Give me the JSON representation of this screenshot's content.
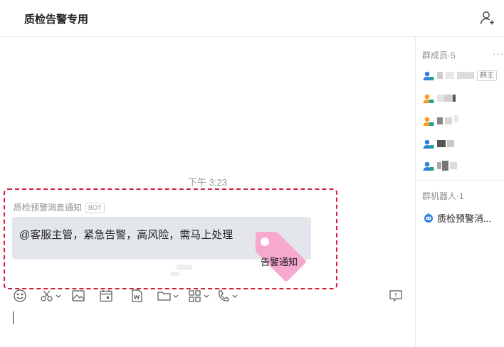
{
  "header": {
    "title": "质检告警专用",
    "add_member_icon": "add-user-icon"
  },
  "chat": {
    "timestamp": "下午 3:23",
    "message": {
      "sender": "质检预警消息通知",
      "sender_badge": "BOT",
      "text": "@客服主管，紧急告警，高风险，需马上处理",
      "tag_label": "告警通知",
      "tag_color": "#f6a8cf",
      "highlight_color": "#d51f3a"
    }
  },
  "toolbar": {
    "items": [
      "emoji-icon",
      "scissors-icon",
      "image-icon",
      "calendar-icon",
      "word-doc-icon",
      "folder-icon",
      "apps-icon",
      "phone-icon",
      "feedback-icon"
    ]
  },
  "sidebar": {
    "members_title": "群成员·5",
    "more_label": "···",
    "owner_badge": "群主",
    "member_icon_colors": [
      "#2f7ee0",
      "#ff9a1f",
      "#ff9a1f",
      "#2f7ee0",
      "#2f7ee0"
    ],
    "bots_title": "群机器人·1",
    "bot_name": "质检预警消..."
  }
}
